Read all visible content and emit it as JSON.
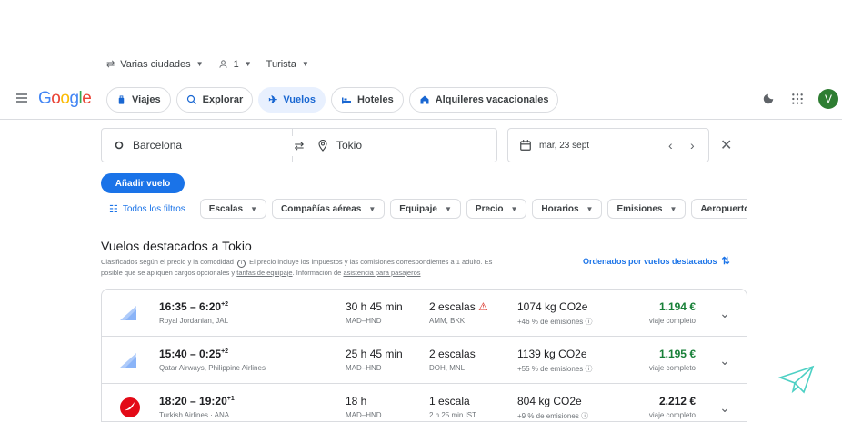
{
  "top_selectors": {
    "trip_type": "Varias ciudades",
    "passengers": "1",
    "cabin": "Turista"
  },
  "header": {
    "logo": "Google",
    "nav": [
      {
        "label": "Viajes",
        "icon": "suitcase-icon"
      },
      {
        "label": "Explorar",
        "icon": "explore-icon"
      },
      {
        "label": "Vuelos",
        "icon": "plane-icon"
      },
      {
        "label": "Hoteles",
        "icon": "bed-icon"
      },
      {
        "label": "Alquileres vacacionales",
        "icon": "house-icon"
      }
    ],
    "avatar_letter": "V"
  },
  "search": {
    "origin": "Barcelona",
    "destination": "Tokio",
    "date": "mar, 23 sept"
  },
  "add_flight_label": "Añadir vuelo",
  "filters": {
    "all_filters": "Todos los filtros",
    "chips": [
      "Escalas",
      "Compañías aéreas",
      "Equipaje",
      "Precio",
      "Horarios",
      "Emisiones",
      "Aeropuertos de cor"
    ]
  },
  "featured": {
    "title": "Vuelos destacados a Tokio",
    "desc_line1": "Clasificados según el precio y la comodidad",
    "desc_line1b": "El precio incluye los impuestos y las comisiones correspondientes a 1 adulto. Es",
    "desc_line2a": "posible que se apliquen cargos opcionales y",
    "desc_link1": "tarifas de equipaje",
    "desc_line2b": ". Información de",
    "desc_link2": "asistencia para pasajeros",
    "sort_label": "Ordenados por vuelos destacados"
  },
  "flights": [
    {
      "dep": "16:35",
      "arr": "6:20",
      "arr_offset": "+2",
      "airline": "Royal Jordanian, JAL",
      "duration": "30 h 45 min",
      "route": "MAD–HND",
      "stops": "2 escalas",
      "stop_info": "AMM, BKK",
      "co2": "1074 kg CO2e",
      "emissions": "+46 % de emisiones",
      "price": "1.194 €",
      "price_color": "#188038",
      "trip": "viaje completo",
      "logo": "royal-jordanian-logo"
    },
    {
      "dep": "15:40",
      "arr": "0:25",
      "arr_offset": "+2",
      "airline": "Qatar Airways, Philippine Airlines",
      "duration": "25 h 45 min",
      "route": "MAD–HND",
      "stops": "2 escalas",
      "stop_info": "DOH, MNL",
      "co2": "1139 kg CO2e",
      "emissions": "+55 % de emisiones",
      "price": "1.195 €",
      "price_color": "#188038",
      "trip": "viaje completo",
      "logo": "multi-airline-logo"
    },
    {
      "dep": "18:20",
      "arr": "19:20",
      "arr_offset": "+1",
      "airline": "Turkish Airlines · ANA",
      "duration": "18 h",
      "route": "MAD–HND",
      "stops": "1 escala",
      "stop_info": "2 h 25 min IST",
      "co2": "804 kg CO2e",
      "emissions": "+9 % de emisiones",
      "price": "2.212 €",
      "price_color": "#202124",
      "trip": "viaje completo",
      "logo": "turkish-airlines-logo"
    }
  ]
}
